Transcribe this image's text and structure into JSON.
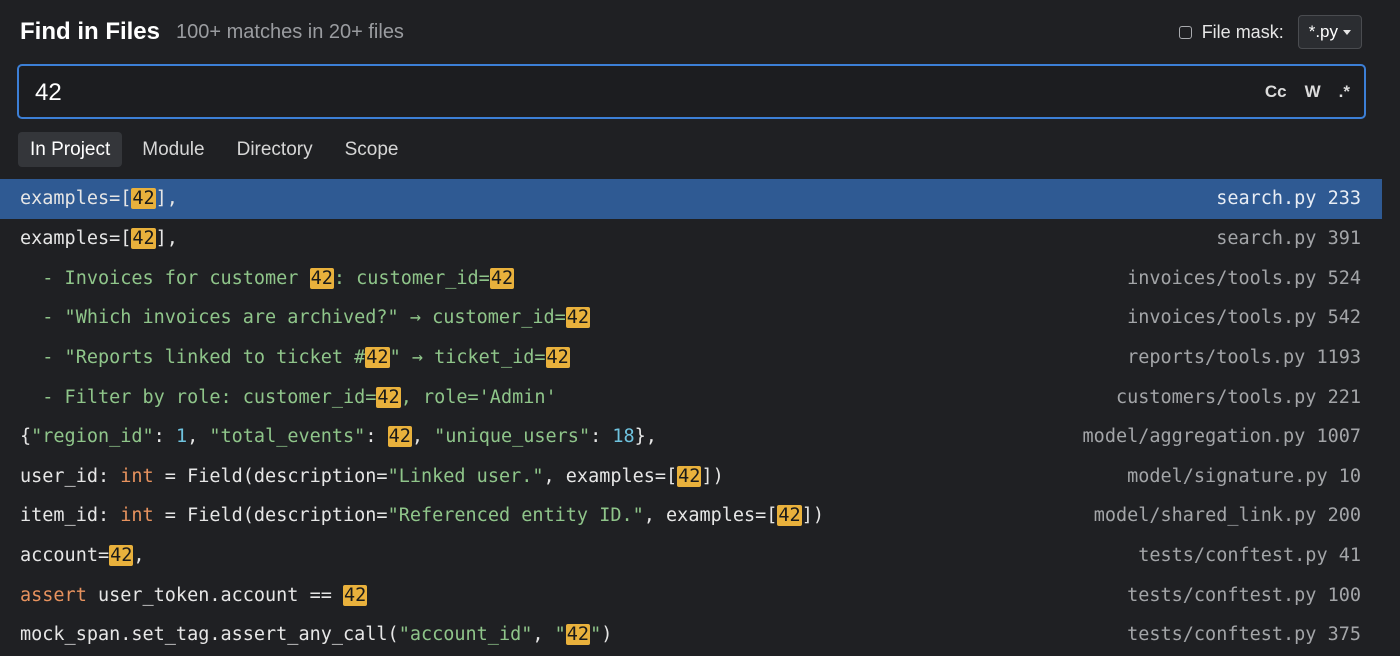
{
  "header": {
    "title": "Find in Files",
    "summary": "100+ matches in 20+ files",
    "file_mask_label": "File mask:",
    "file_mask_value": "*.py",
    "file_mask_checked": false
  },
  "search": {
    "query": "42",
    "toggles": [
      "Cc",
      "W",
      ".*"
    ]
  },
  "tabs": [
    {
      "label": "In Project",
      "active": true
    },
    {
      "label": "Module",
      "active": false
    },
    {
      "label": "Directory",
      "active": false
    },
    {
      "label": "Scope",
      "active": false
    }
  ],
  "colors": {
    "accent": "#3c7fd6",
    "selection": "#2f5a93",
    "match_highlight": "#e9b13c",
    "string": "#8fc58a",
    "number": "#6fc3df",
    "keyword": "#e7925e"
  },
  "results": [
    {
      "selected": true,
      "file": "search.py 233",
      "segments": [
        {
          "t": "examples=[",
          "k": "plain"
        },
        {
          "t": "42",
          "k": "hl"
        },
        {
          "t": "],",
          "k": "plain"
        }
      ]
    },
    {
      "selected": false,
      "file": "search.py 391",
      "segments": [
        {
          "t": "examples=[",
          "k": "plain"
        },
        {
          "t": "42",
          "k": "hl"
        },
        {
          "t": "],",
          "k": "plain"
        }
      ]
    },
    {
      "selected": false,
      "file": "invoices/tools.py 524",
      "segments": [
        {
          "t": "  - Invoices for customer ",
          "k": "comment"
        },
        {
          "t": "42",
          "k": "hl"
        },
        {
          "t": ": customer_id=",
          "k": "comment"
        },
        {
          "t": "42",
          "k": "hl"
        }
      ]
    },
    {
      "selected": false,
      "file": "invoices/tools.py 542",
      "segments": [
        {
          "t": "  - \"Which invoices are archived?\" → customer_id=",
          "k": "comment"
        },
        {
          "t": "42",
          "k": "hl"
        }
      ]
    },
    {
      "selected": false,
      "file": "reports/tools.py 1193",
      "segments": [
        {
          "t": "  - \"Reports linked to ticket #",
          "k": "comment"
        },
        {
          "t": "42",
          "k": "hl"
        },
        {
          "t": "\" → ticket_id=",
          "k": "comment"
        },
        {
          "t": "42",
          "k": "hl"
        }
      ]
    },
    {
      "selected": false,
      "file": "customers/tools.py 221",
      "segments": [
        {
          "t": "  - Filter by role: customer_id=",
          "k": "comment"
        },
        {
          "t": "42",
          "k": "hl"
        },
        {
          "t": ", role='Admin'",
          "k": "comment"
        }
      ]
    },
    {
      "selected": false,
      "file": "model/aggregation.py 1007",
      "segments": [
        {
          "t": "{",
          "k": "plain"
        },
        {
          "t": "\"region_id\"",
          "k": "string"
        },
        {
          "t": ": ",
          "k": "plain"
        },
        {
          "t": "1",
          "k": "num"
        },
        {
          "t": ", ",
          "k": "plain"
        },
        {
          "t": "\"total_events\"",
          "k": "string"
        },
        {
          "t": ": ",
          "k": "plain"
        },
        {
          "t": "42",
          "k": "hl"
        },
        {
          "t": ", ",
          "k": "plain"
        },
        {
          "t": "\"unique_users\"",
          "k": "string"
        },
        {
          "t": ": ",
          "k": "plain"
        },
        {
          "t": "18",
          "k": "num"
        },
        {
          "t": "},",
          "k": "plain"
        }
      ]
    },
    {
      "selected": false,
      "file": "model/signature.py 10",
      "segments": [
        {
          "t": "user_id: ",
          "k": "plain"
        },
        {
          "t": "int",
          "k": "keyword"
        },
        {
          "t": " = Field(description=",
          "k": "plain"
        },
        {
          "t": "\"Linked user.\"",
          "k": "string"
        },
        {
          "t": ", examples=[",
          "k": "plain"
        },
        {
          "t": "42",
          "k": "hl"
        },
        {
          "t": "])",
          "k": "plain"
        }
      ]
    },
    {
      "selected": false,
      "file": "model/shared_link.py 200",
      "segments": [
        {
          "t": "item_id: ",
          "k": "plain"
        },
        {
          "t": "int",
          "k": "keyword"
        },
        {
          "t": " = Field(description=",
          "k": "plain"
        },
        {
          "t": "\"Referenced entity ID.\"",
          "k": "string"
        },
        {
          "t": ", examples=[",
          "k": "plain"
        },
        {
          "t": "42",
          "k": "hl"
        },
        {
          "t": "])",
          "k": "plain"
        }
      ]
    },
    {
      "selected": false,
      "file": "tests/conftest.py 41",
      "segments": [
        {
          "t": "account=",
          "k": "plain"
        },
        {
          "t": "42",
          "k": "hl"
        },
        {
          "t": ",",
          "k": "plain"
        }
      ]
    },
    {
      "selected": false,
      "file": "tests/conftest.py 100",
      "segments": [
        {
          "t": "assert",
          "k": "keyword"
        },
        {
          "t": " user_token.account == ",
          "k": "plain"
        },
        {
          "t": "42",
          "k": "hl"
        }
      ]
    },
    {
      "selected": false,
      "file": "tests/conftest.py 375",
      "segments": [
        {
          "t": "mock_span.set_tag.assert_any_call(",
          "k": "plain"
        },
        {
          "t": "\"account_id\"",
          "k": "string"
        },
        {
          "t": ", ",
          "k": "plain"
        },
        {
          "t": "\"",
          "k": "string"
        },
        {
          "t": "42",
          "k": "hl"
        },
        {
          "t": "\"",
          "k": "string"
        },
        {
          "t": ")",
          "k": "plain"
        }
      ]
    }
  ]
}
